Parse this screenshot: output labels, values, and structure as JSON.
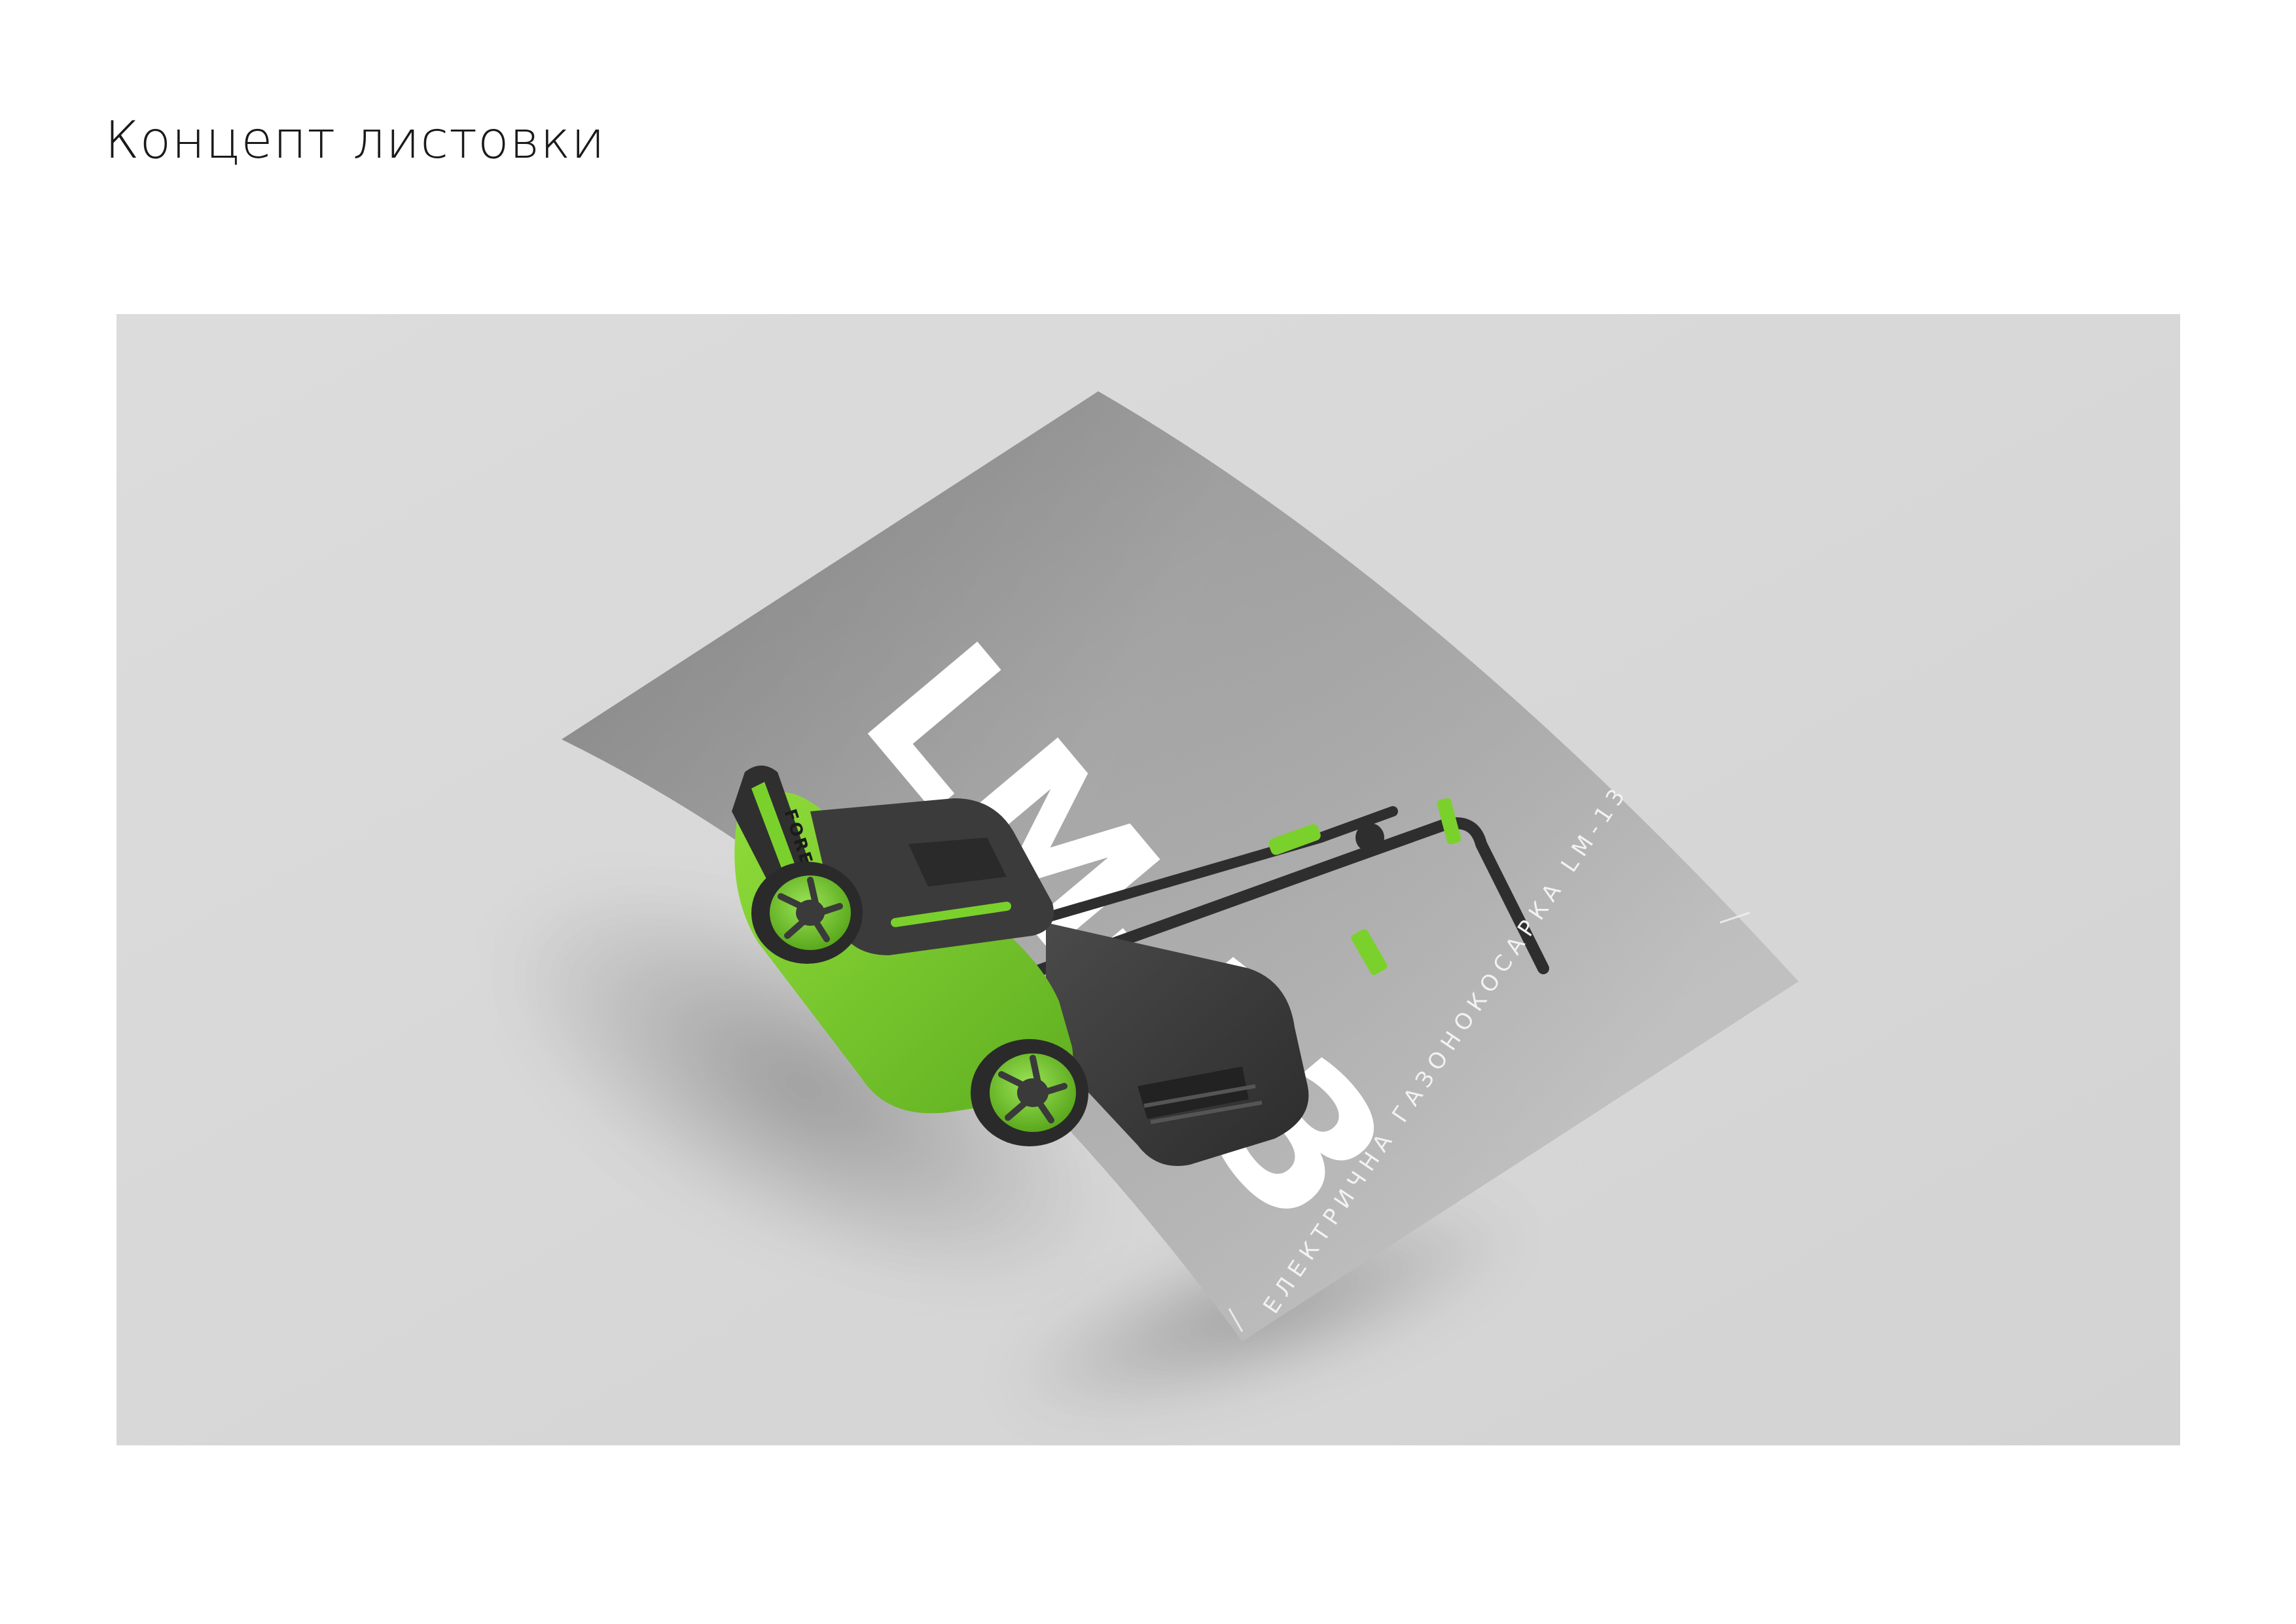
{
  "page": {
    "heading": "Концепт листовки"
  },
  "flyer": {
    "model_text": "LM-13",
    "caption": "ЕЛЕКТРИЧНА ГАЗОНОКОСАРКА LM-13",
    "brand": "FORESTA"
  },
  "colors": {
    "background": "#ffffff",
    "mockup_backdrop": "#d9d9d9",
    "paper_gray": "#9a9a9a",
    "accent_green": "#7bd12c",
    "mower_dark": "#3c3c3c",
    "model_text_fill": "#ffffff"
  }
}
